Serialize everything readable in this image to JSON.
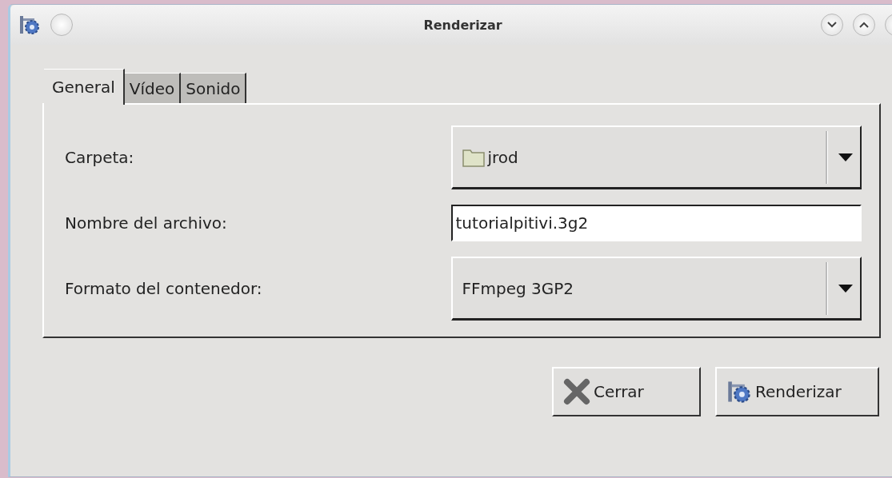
{
  "window": {
    "title": "Renderizar"
  },
  "tabs": [
    {
      "label": "General",
      "selected": true
    },
    {
      "label": "Vídeo",
      "selected": false
    },
    {
      "label": "Sonido",
      "selected": false
    }
  ],
  "fields": [
    {
      "kind": "folder",
      "label": "Carpeta:",
      "value": "jrod"
    },
    {
      "kind": "entry",
      "label": "Nombre del archivo:",
      "value": "tutorialpitivi.3g2"
    },
    {
      "kind": "combo",
      "label": "Formato del contenedor:",
      "value": "FFmpeg 3GP2"
    }
  ],
  "buttons": [
    {
      "kind": "close",
      "label": "Cerrar"
    },
    {
      "kind": "render",
      "label": "Renderizar"
    }
  ]
}
